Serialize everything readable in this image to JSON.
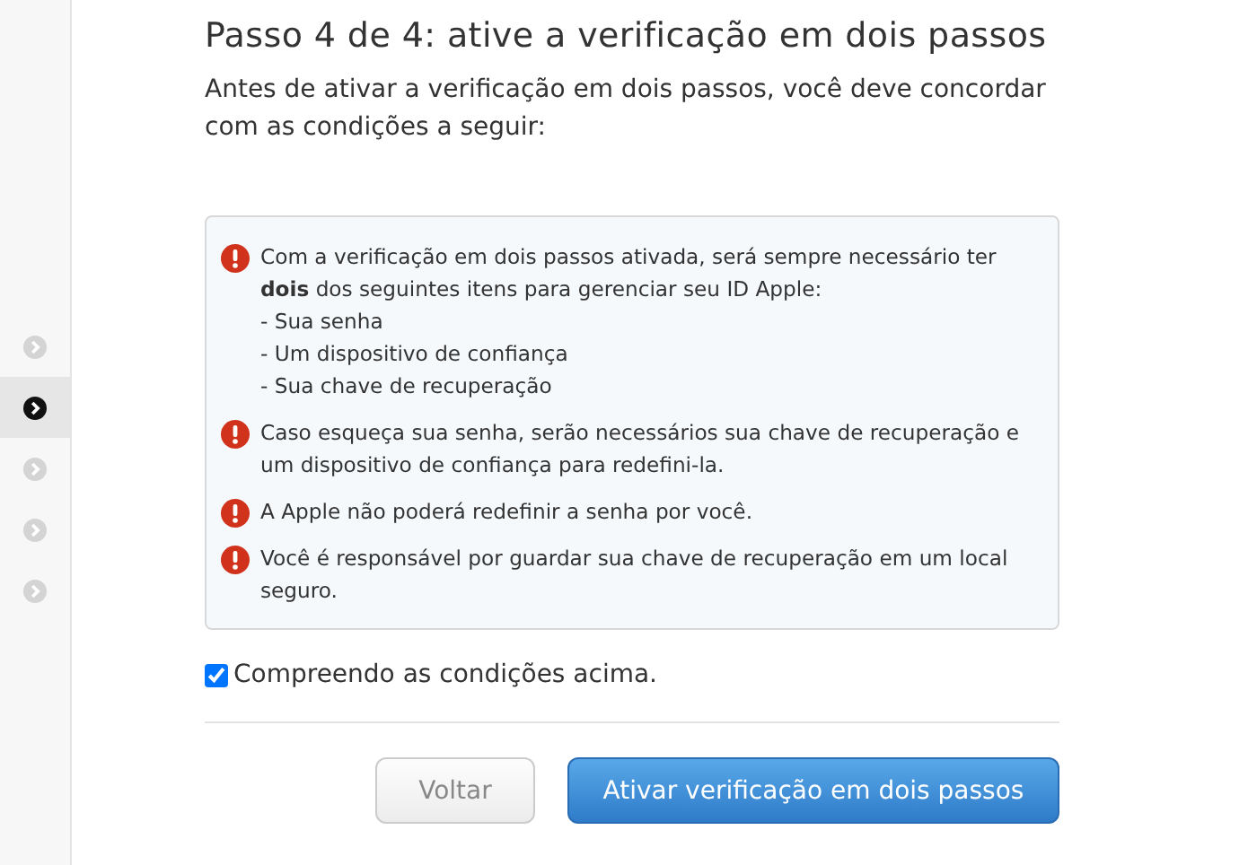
{
  "steps": [
    {
      "selected": false
    },
    {
      "selected": true
    },
    {
      "selected": false
    },
    {
      "selected": false
    },
    {
      "selected": false
    }
  ],
  "title": "Passo 4 de 4: ative a verificação em dois passos",
  "intro": "Antes de ativar a verificação em dois passos, você deve concordar com as condições a seguir:",
  "conditions": [
    {
      "text": "Com a verificação em dois passos ativada, será sempre necessário ter **dois** dos seguintes itens para gerenciar seu ID Apple:",
      "items": [
        "- Sua senha",
        "- Um dispositivo de confiança",
        "- Sua chave de recuperação"
      ]
    },
    {
      "text": "Caso esqueça sua senha, serão necessários sua chave de recuperação e um dispositivo de confiança para redefini-la."
    },
    {
      "text": "A Apple não poderá redefinir a senha por você."
    },
    {
      "text": "Você é responsável por guardar sua chave de recuperação em um local seguro."
    }
  ],
  "agree": {
    "label": "Compreendo as condições acima.",
    "checked": true
  },
  "buttons": {
    "back": "Voltar",
    "primary": "Ativar verificação em dois passos"
  }
}
